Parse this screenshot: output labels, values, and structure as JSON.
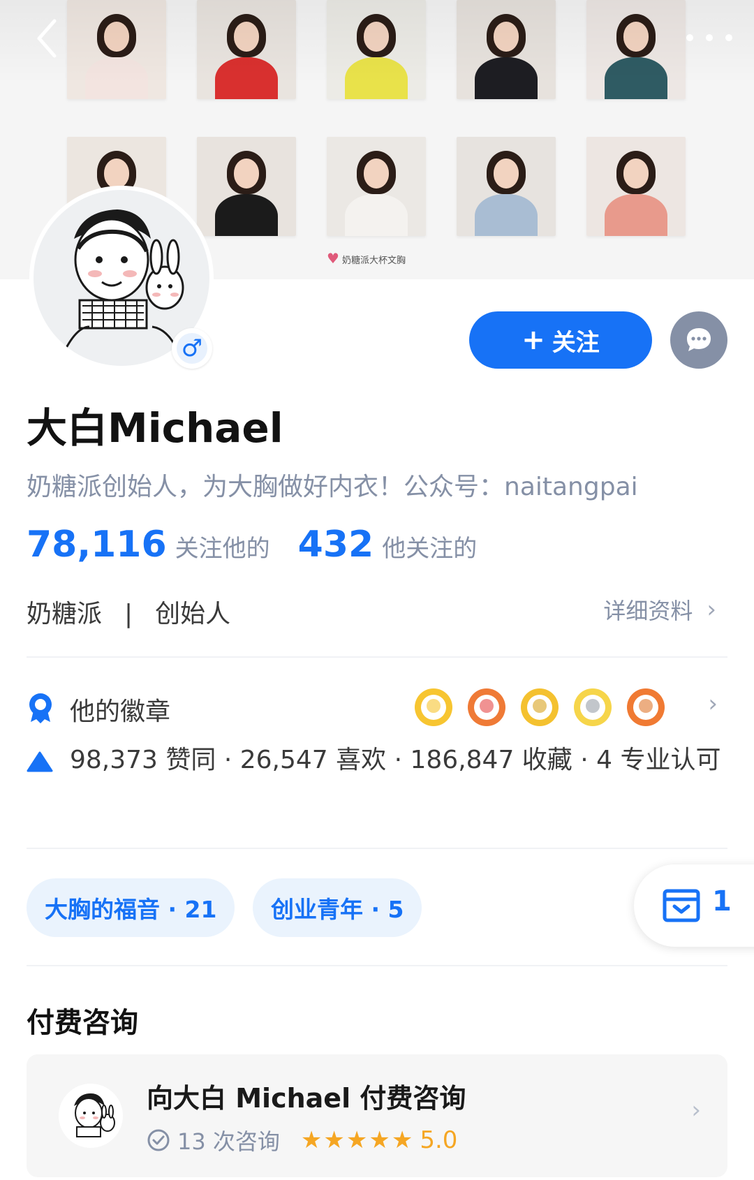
{
  "profile": {
    "name": "大白Michael",
    "bio": "奶糖派创始人，为大胸做好内衣！公众号：naitangpai",
    "gender_symbol": "♂"
  },
  "cover": {
    "brand_text": "奶糖派大杯文胸"
  },
  "actions": {
    "follow_plus": "+",
    "follow_label": "关注"
  },
  "stats": {
    "followers_count": "78,116",
    "followers_label": "关注他的",
    "following_count": "432",
    "following_label": "他关注的"
  },
  "work": {
    "company": "奶糖派",
    "separator": "|",
    "position": "创始人",
    "detail_label": "详细资料",
    "chevron": "›"
  },
  "badges": {
    "title": "他的徽章",
    "medal_colors": [
      "#f7c531",
      "#ef7a36",
      "#f4c12f",
      "#f6d54a",
      "#f07a33"
    ],
    "chevron": "›"
  },
  "achievements": {
    "text": "98,373 赞同 · 26,547 喜欢 · 186,847 收藏 · 4 专业认可"
  },
  "columns": [
    {
      "label": "大胸的福音 · 21"
    },
    {
      "label": "创业青年 · 5"
    }
  ],
  "float_card": {
    "count": "1"
  },
  "consult": {
    "section_title": "付费咨询",
    "title": "向大白 Michael 付费咨询",
    "count": "13 次咨询",
    "rating_stars": 5,
    "rating": "5.0",
    "chevron": "›"
  },
  "colors": {
    "brand_blue": "#1772f6",
    "muted_gray": "#8590a6",
    "star_orange": "#f5a623"
  }
}
